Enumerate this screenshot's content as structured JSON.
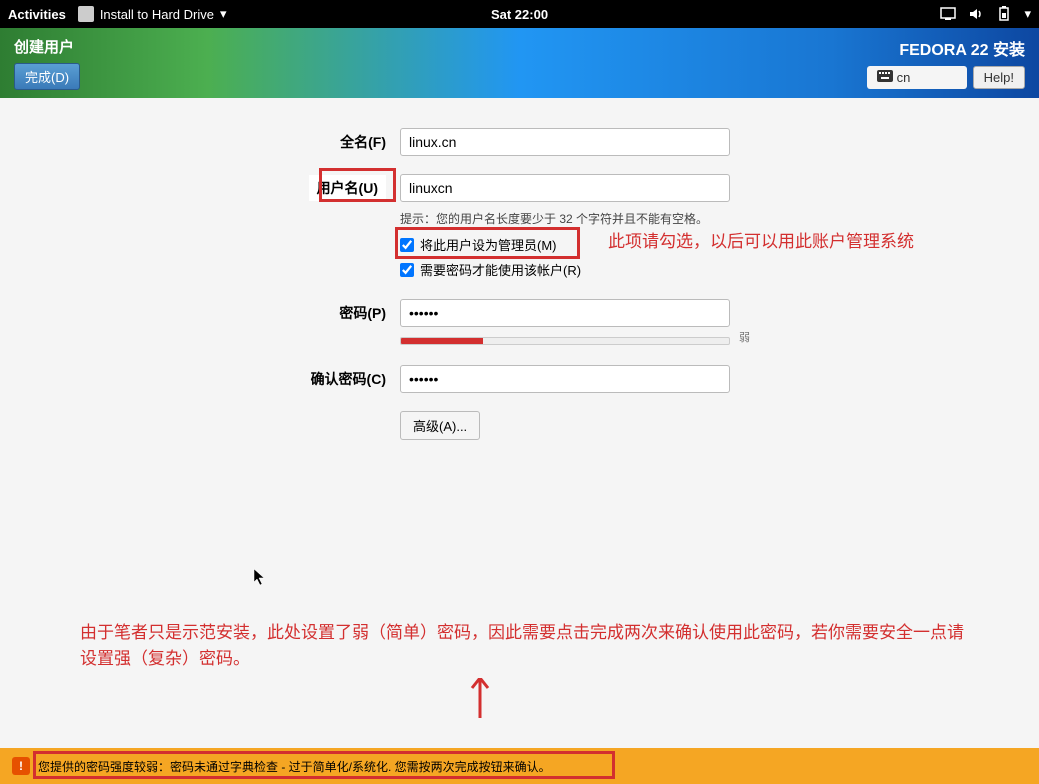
{
  "gnome": {
    "activities": "Activities",
    "app_name": "Install to Hard Drive",
    "clock": "Sat 22:00"
  },
  "header": {
    "title": "创建用户",
    "done": "完成(D)",
    "product": "FEDORA 22 安装",
    "keyboard": "cn",
    "help": "Help!"
  },
  "form": {
    "fullname_label": "全名(F)",
    "fullname_value": "linux.cn",
    "username_label": "用户名(U)",
    "username_value": "linuxcn",
    "username_hint": "提示：您的用户名长度要少于 32 个字符并且不能有空格。",
    "admin_cb": "将此用户设为管理员(M)",
    "require_pw_cb": "需要密码才能使用该帐户(R)",
    "password_label": "密码(P)",
    "password_value": "••••••",
    "strength_label": "弱",
    "confirm_label": "确认密码(C)",
    "confirm_value": "••••••",
    "advanced": "高级(A)..."
  },
  "annotations": {
    "admin_note": "此项请勾选，以后可以用此账户管理系统",
    "password_note": "由于笔者只是示范安装，此处设置了弱（简单）密码，因此需要点击完成两次来确认使用此密码，若你需要安全一点请设置强（复杂）密码。"
  },
  "warning": {
    "text": "您提供的密码强度较弱：密码未通过字典检查 - 过于简单化/系统化. 您需按两次完成按钮来确认。"
  }
}
